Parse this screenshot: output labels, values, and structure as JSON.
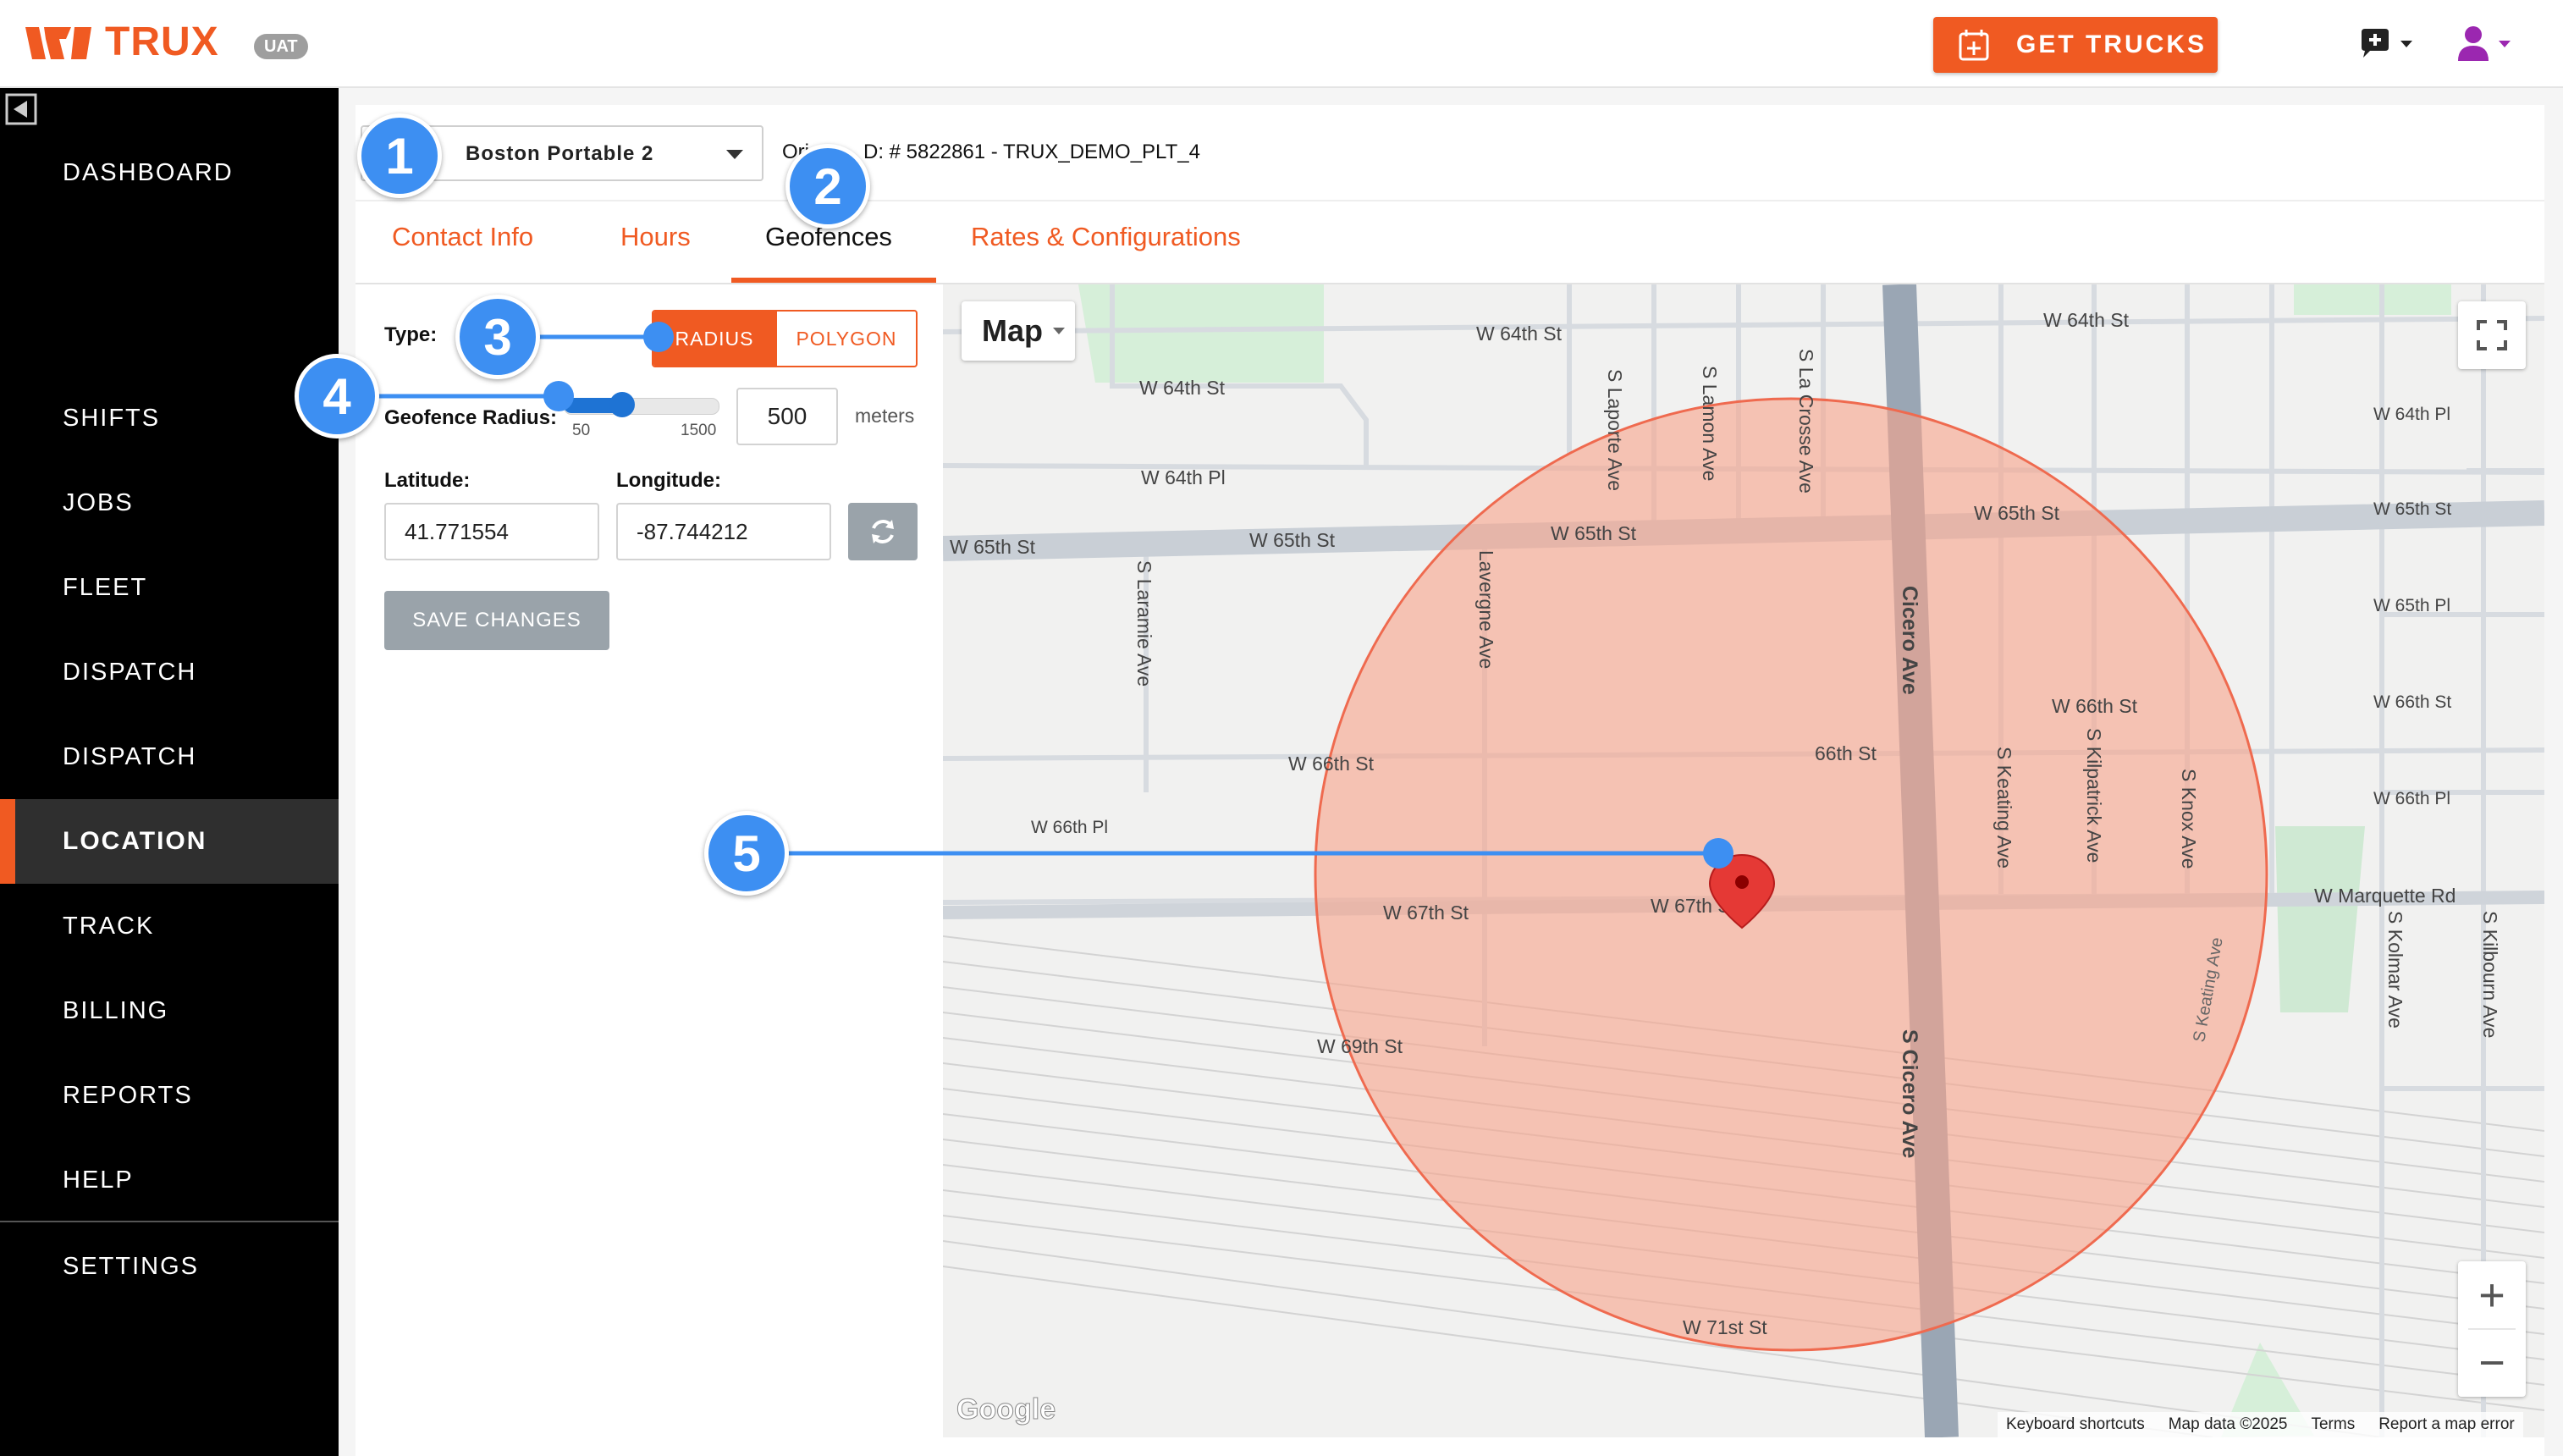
{
  "header": {
    "brand": "TRUX",
    "env_badge": "UAT",
    "get_trucks_label": "GET TRUCKS",
    "brand_color": "#f05a22",
    "icons": {
      "logo": "trux-logo-icon",
      "get_trucks": "calendar-plus-icon",
      "chat": "chat-icon",
      "user": "user-icon"
    }
  },
  "sidebar": {
    "items": [
      {
        "label": "DASHBOARD"
      },
      {
        "label": "SHIFTS"
      },
      {
        "label": "JOBS"
      },
      {
        "label": "FLEET"
      },
      {
        "label": "DISPATCH"
      },
      {
        "label": "DISPATCH"
      },
      {
        "label": "LOCATION",
        "active": true
      },
      {
        "label": "TRACK"
      },
      {
        "label": "BILLING"
      },
      {
        "label": "REPORTS"
      },
      {
        "label": "HELP"
      },
      {
        "label": "SETTINGS"
      }
    ]
  },
  "location": {
    "selected": "Boston Portable 2",
    "origin_prefix": "Ori",
    "origin_suffix": "D: # 5822861 - TRUX_DEMO_PLT_4"
  },
  "tabs": [
    {
      "label": "Contact Info"
    },
    {
      "label": "Hours"
    },
    {
      "label": "Geofences",
      "active": true
    },
    {
      "label": "Rates & Configurations"
    }
  ],
  "geofence": {
    "type_label": "Type:",
    "type_options": [
      "RADIUS",
      "POLYGON"
    ],
    "type_selected": "RADIUS",
    "radius_label": "Geofence Radius:",
    "radius_min": "50",
    "radius_max": "1500",
    "radius_value": "500",
    "radius_unit": "meters",
    "latitude_label": "Latitude:",
    "latitude": "41.771554",
    "longitude_label": "Longitude:",
    "longitude": "-87.744212",
    "save_label": "SAVE CHANGES"
  },
  "map": {
    "type_label": "Map",
    "zoom_in": "+",
    "zoom_out": "−",
    "google": "Google",
    "attribution": [
      "Keyboard shortcuts",
      "Map data ©2025",
      "Terms",
      "Report a map error"
    ],
    "geofence_fill": "#f9a48a",
    "street_labels": {
      "w64th_st_a": "W 64th St",
      "w64th_st_b": "W 64th St",
      "w64th_st_c": "W 64th St",
      "w64th_pl_a": "W 64th Pl",
      "w64th_pl_b": "W 64th Pl",
      "w65th_st_a": "W 65th St",
      "w65th_st_b": "W 65th St",
      "w65th_st_c": "W 65th St",
      "w65th_st_d": "W 65th St",
      "w65th_st_e": "W 65th St",
      "w65th_pl": "W 65th Pl",
      "w66th_st_a": "W 66th St",
      "w66th_st_b": "66th St",
      "w66th_st_c": "W 66th St",
      "w66th_st_d": "W 66th St",
      "w66th_pl_a": "W 66th Pl",
      "w66th_pl_b": "W 66th Pl",
      "w67th_st_a": "W 67th St",
      "w67th_st_b": "W 67th St",
      "marquette": "W Marquette Rd",
      "w69th": "W 69th St",
      "w71st": "W 71st St",
      "laporte": "S Laporte Ave",
      "lamon": "S Lamon Ave",
      "lacrosse": "S La Crosse Ave",
      "laramie": "S Laramie Ave",
      "lavergne": "Lavergne Ave",
      "cicero_a": "Cicero Ave",
      "cicero_b": "S Cicero Ave",
      "keating_a": "S Keating Ave",
      "keating_b": "S Keating Ave",
      "kilpatrick": "S Kilpatrick Ave",
      "knox": "S Knox Ave",
      "kolmar": "S Kolmar Ave",
      "kilbourn": "S Kilbourn Ave"
    }
  },
  "callouts": [
    "1",
    "2",
    "3",
    "4",
    "5"
  ],
  "colors": {
    "accent": "#f05a22",
    "callout": "#3d8ff2",
    "slider": "#1e73d4"
  }
}
